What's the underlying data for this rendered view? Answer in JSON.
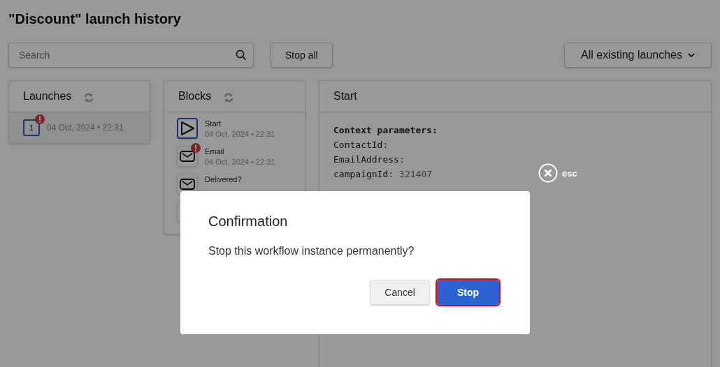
{
  "page": {
    "title": "\"Discount\" launch history"
  },
  "toolbar": {
    "search": {
      "placeholder": "Search"
    },
    "stop_all": "Stop all",
    "filter": "All existing launches"
  },
  "launches": {
    "title": "Launches",
    "items": [
      {
        "number": "1",
        "time": "04 Oct, 2024 • 22:31",
        "error": true,
        "selected": true
      }
    ]
  },
  "blocks": {
    "title": "Blocks",
    "items": [
      {
        "kind": "start",
        "name": "Start",
        "time": "04 Oct, 2024 • 22:31",
        "error": false,
        "selected": true
      },
      {
        "kind": "email",
        "name": "Email",
        "time": "04 Oct, 2024 • 22:31",
        "error": true,
        "selected": false
      },
      {
        "kind": "email",
        "name": "Delivered?",
        "error": false,
        "selected": false
      },
      {
        "kind": "other"
      }
    ]
  },
  "details": {
    "title": "Start",
    "heading": "Context parameters:",
    "params": [
      {
        "key": "ContactId:"
      },
      {
        "key": "EmailAddress:"
      },
      {
        "key": "campaignId:",
        "value": "321407"
      }
    ]
  },
  "close_hint": "esc",
  "dialog": {
    "title": "Confirmation",
    "message": "Stop this workflow instance permanently?",
    "buttons": [
      {
        "label": "Cancel",
        "primary": false,
        "highlighted": false
      },
      {
        "label": "Stop",
        "primary": true,
        "highlighted": true
      }
    ]
  }
}
